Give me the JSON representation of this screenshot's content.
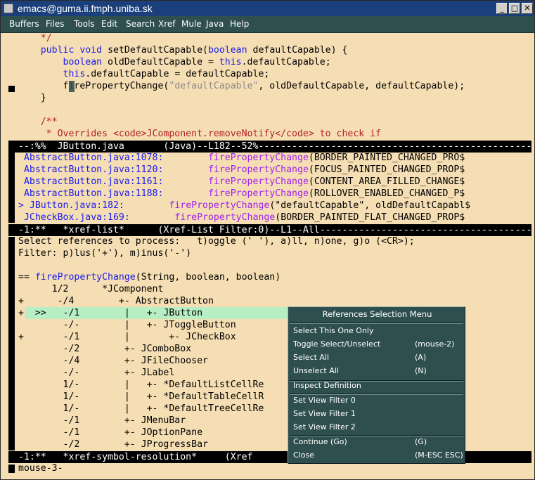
{
  "window": {
    "title": "emacs@guma.ii.fmph.uniba.sk",
    "buttons": [
      "_",
      "□",
      "✕"
    ]
  },
  "menubar": [
    "Buffers",
    "Files",
    "Tools",
    "Edit",
    "Search",
    "Xref",
    "Mule",
    "Java",
    "Help"
  ],
  "code_window": {
    "lines": [
      [
        {
          "t": "    */",
          "c": "cm"
        }
      ],
      [
        {
          "t": "    "
        },
        {
          "t": "public",
          "c": "kw"
        },
        {
          "t": " "
        },
        {
          "t": "void",
          "c": "kw"
        },
        {
          "t": " setDefaultCapable("
        },
        {
          "t": "boolean",
          "c": "kw"
        },
        {
          "t": " defaultCapable) {"
        }
      ],
      [
        {
          "t": "        "
        },
        {
          "t": "boolean",
          "c": "kw"
        },
        {
          "t": " oldDefaultCapable = "
        },
        {
          "t": "this",
          "c": "kw"
        },
        {
          "t": ".defaultCapable;"
        }
      ],
      [
        {
          "t": "        "
        },
        {
          "t": "this",
          "c": "kw"
        },
        {
          "t": ".defaultCapable = defaultCapable;"
        }
      ],
      [
        {
          "t": "        firePropertyChange("
        },
        {
          "t": "\"defaultCapable\"",
          "c": "str"
        },
        {
          "t": ", oldDefaultCapable, defaultCapable);"
        }
      ],
      [
        {
          "t": "    }"
        }
      ],
      [
        {
          "t": ""
        }
      ],
      [
        {
          "t": "    /**",
          "c": "cm"
        }
      ],
      [
        {
          "t": "     * Overrides <code>JComponent.removeNotify</code> to check if",
          "c": "cm"
        }
      ]
    ],
    "modeline": "--:%%  JButton.java       (Java)--L182--52%----------------------------------------------------------"
  },
  "xref_list": {
    "lines": [
      [
        {
          "t": " AbstractButton.java:1078:",
          "c": "xref-ref"
        },
        {
          "t": "        "
        },
        {
          "t": "firePropertyChange",
          "c": "xref-fn"
        },
        {
          "t": "(BORDER_PAINTED_CHANGED_PRO$"
        }
      ],
      [
        {
          "t": " AbstractButton.java:1120:",
          "c": "xref-ref"
        },
        {
          "t": "        "
        },
        {
          "t": "firePropertyChange",
          "c": "xref-fn"
        },
        {
          "t": "(FOCUS_PAINTED_CHANGED_PROP$"
        }
      ],
      [
        {
          "t": " AbstractButton.java:1161:",
          "c": "xref-ref"
        },
        {
          "t": "        "
        },
        {
          "t": "firePropertyChange",
          "c": "xref-fn"
        },
        {
          "t": "(CONTENT_AREA_FILLED_CHANGE$"
        }
      ],
      [
        {
          "t": " AbstractButton.java:1188:",
          "c": "xref-ref"
        },
        {
          "t": "        "
        },
        {
          "t": "firePropertyChange",
          "c": "xref-fn"
        },
        {
          "t": "(ROLLOVER_ENABLED_CHANGED_P$"
        }
      ],
      [
        {
          "t": "> JButton.java:182:",
          "c": "xref-ref"
        },
        {
          "t": "        "
        },
        {
          "t": "firePropertyChange",
          "c": "xref-fn"
        },
        {
          "t": "(\"defaultCapable\", oldDefaultCapabl$"
        }
      ],
      [
        {
          "t": " JCheckBox.java:169:",
          "c": "xref-ref"
        },
        {
          "t": "        "
        },
        {
          "t": "firePropertyChange",
          "c": "xref-fn"
        },
        {
          "t": "(BORDER_PAINTED_FLAT_CHANGED_PROP$"
        }
      ]
    ],
    "modeline": "-1:**   *xref-list*      (Xref-List Filter:0)--L1--All------------------------------------------------"
  },
  "resolution": {
    "lines": [
      [
        {
          "t": "Select references to process:   t)oggle (' '), a)ll, n)one, g)o (<CR>);"
        }
      ],
      [
        {
          "t": "Filter: p)lus('+'), m)inus('-')"
        }
      ],
      [
        {
          "t": ""
        }
      ],
      [
        {
          "t": "== "
        },
        {
          "t": "firePropertyChange",
          "c": "fn"
        },
        {
          "t": "(String, boolean, boolean)"
        }
      ],
      [
        {
          "t": "      1/2      *JComponent"
        }
      ],
      [
        {
          "t": "+      -/4        +- AbstractButton"
        }
      ],
      [
        {
          "t": "+  >>   -/1        |   +- JButton"
        }
      ],
      [
        {
          "t": "        -/-        |   +- JToggleButton"
        }
      ],
      [
        {
          "t": "+       -/1        |       +- JCheckBox"
        }
      ],
      [
        {
          "t": "        -/2        +- JComboBox"
        }
      ],
      [
        {
          "t": "        -/4        +- JFileChooser"
        }
      ],
      [
        {
          "t": "        -/-        +- JLabel"
        }
      ],
      [
        {
          "t": "        1/-        |   +- *DefaultListCellRe"
        }
      ],
      [
        {
          "t": "        1/-        |   +- *DefaultTableCellR"
        }
      ],
      [
        {
          "t": "        1/-        |   +- *DefaultTreeCellRe"
        }
      ],
      [
        {
          "t": "        -/1        +- JMenuBar"
        }
      ],
      [
        {
          "t": "        -/1        +- JOptionPane"
        }
      ],
      [
        {
          "t": "        -/2        +- JProgressBar"
        }
      ]
    ],
    "modeline": "-1:**   *xref-symbol-resolution*     (Xref"
  },
  "popup": {
    "title": "References Selection Menu",
    "items": [
      {
        "label": "Select This One Only",
        "key": ""
      },
      {
        "label": "Toggle Select/Unselect",
        "key": "(mouse-2)"
      },
      {
        "label": "Select All",
        "key": "(A)"
      },
      {
        "label": "Unselect All",
        "key": "(N)"
      },
      {
        "label": "Inspect Definition",
        "key": ""
      },
      {
        "label": "Set View Filter 0",
        "key": ""
      },
      {
        "label": "Set View Filter 1",
        "key": ""
      },
      {
        "label": "Set View Filter 2",
        "key": ""
      },
      {
        "label": "Continue (Go)",
        "key": "(G)"
      },
      {
        "label": "Close",
        "key": "(M-ESC ESC)"
      }
    ]
  },
  "minibuffer": "mouse-3-"
}
